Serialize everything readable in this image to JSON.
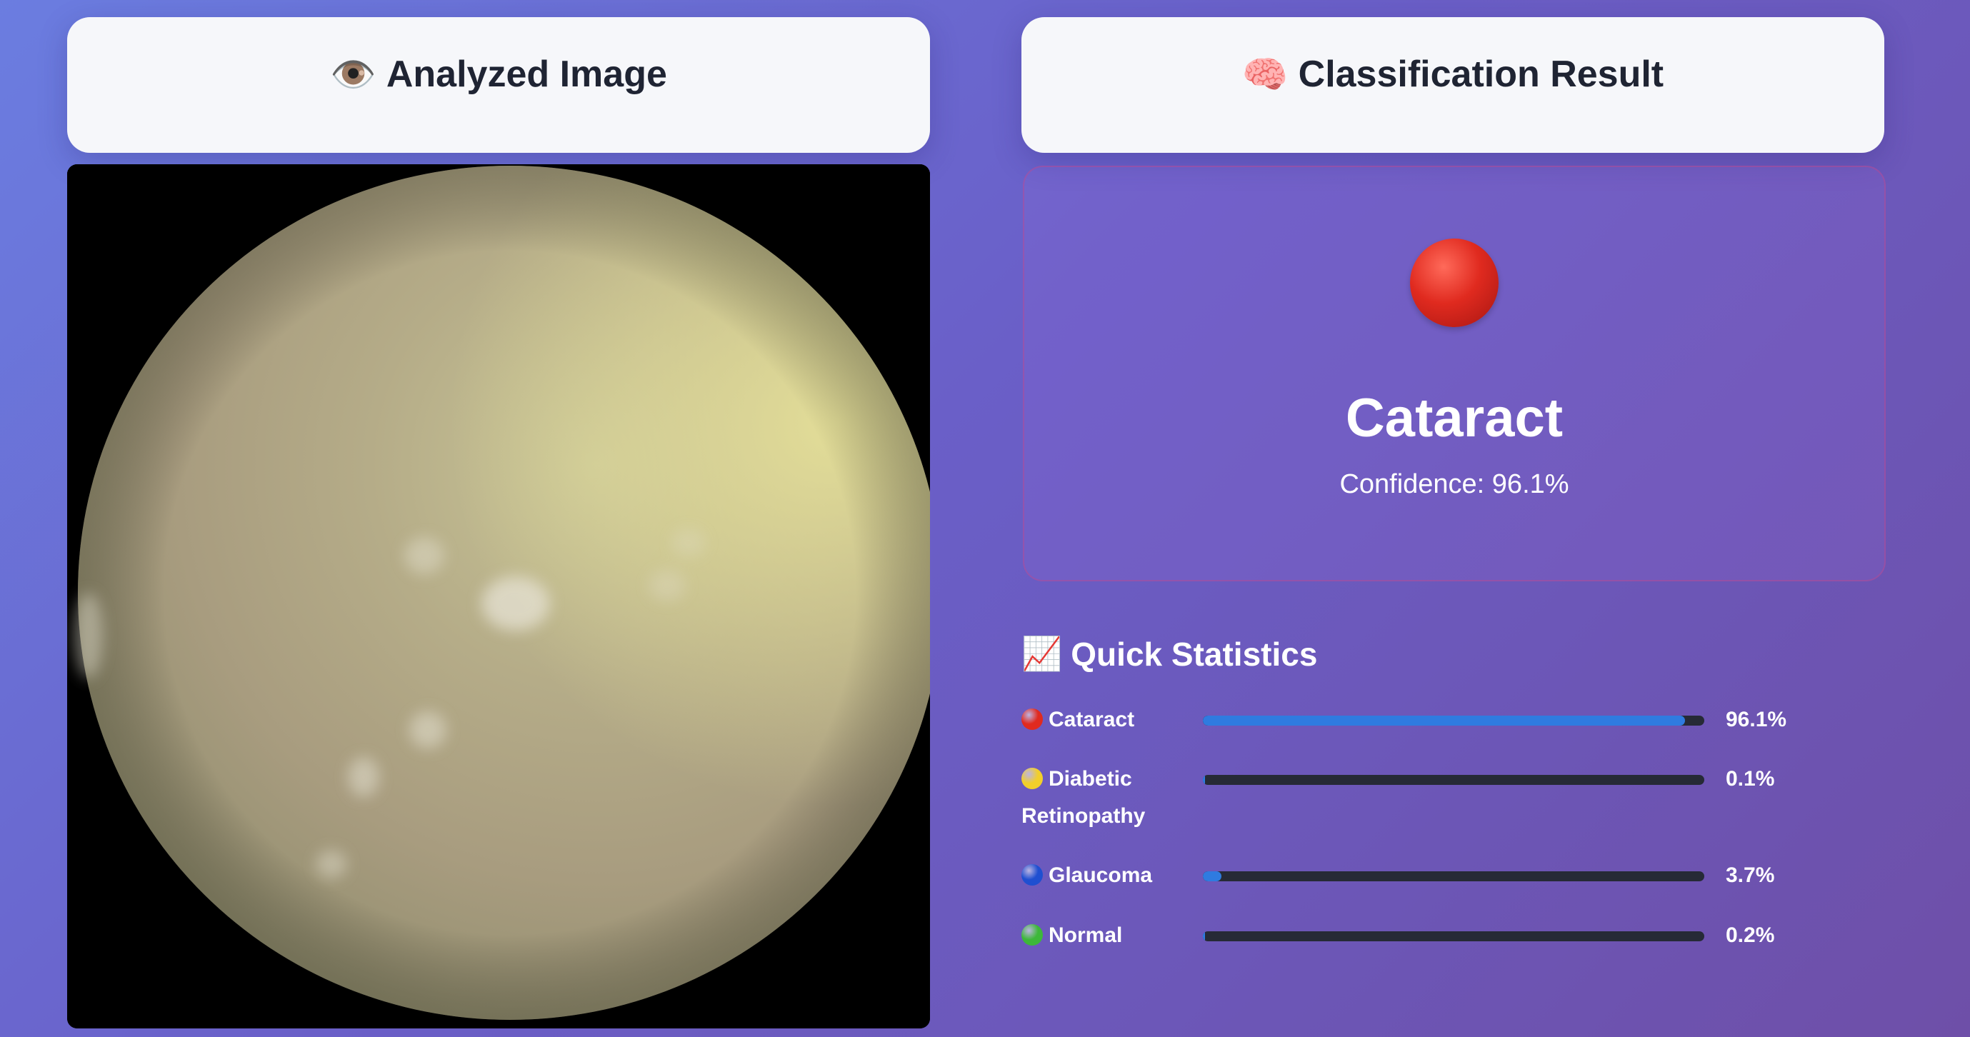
{
  "left_panel": {
    "icon": "👁️",
    "title": "Analyzed Image"
  },
  "right_panel": {
    "icon": "🧠",
    "title": "Classification Result"
  },
  "result": {
    "indicator_icon": "red-circle",
    "label": "Cataract",
    "confidence_text": "Confidence: 96.1%",
    "color": "#e02a1f"
  },
  "stats": {
    "icon": "📈",
    "title": "Quick Statistics",
    "items": [
      {
        "label": "Cataract",
        "value": 0.961,
        "percent": "96.1%",
        "dot_color": "#e02a1f"
      },
      {
        "label": "Diabetic Retinopathy",
        "value": 0.001,
        "percent": "0.1%",
        "dot_color": "#f2cf2a"
      },
      {
        "label": "Glaucoma",
        "value": 0.037,
        "percent": "3.7%",
        "dot_color": "#1f4fd1"
      },
      {
        "label": "Normal",
        "value": 0.002,
        "percent": "0.2%",
        "dot_color": "#3db83a"
      }
    ]
  },
  "colors": {
    "accent_bar": "#2f7be0",
    "bar_track": "#262a36"
  }
}
